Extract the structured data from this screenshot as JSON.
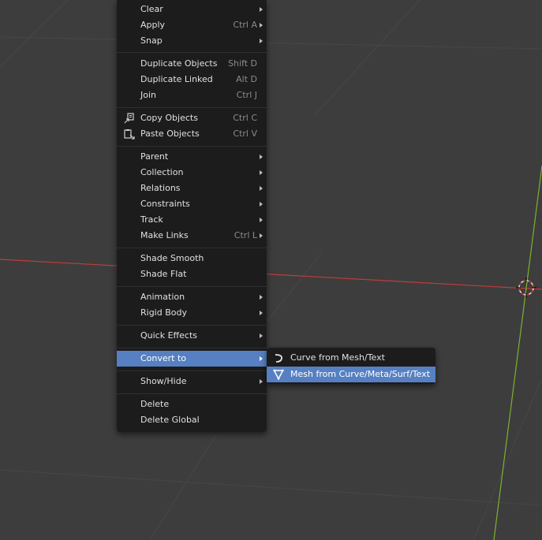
{
  "menu": {
    "items": [
      {
        "label": "Clear",
        "shortcut": "",
        "submenu": true
      },
      {
        "label": "Apply",
        "shortcut": "Ctrl A",
        "submenu": true
      },
      {
        "label": "Snap",
        "shortcut": "",
        "submenu": true
      },
      {
        "label": "Duplicate Objects",
        "shortcut": "Shift D",
        "submenu": false
      },
      {
        "label": "Duplicate Linked",
        "shortcut": "Alt D",
        "submenu": false
      },
      {
        "label": "Join",
        "shortcut": "Ctrl J",
        "submenu": false
      },
      {
        "label": "Copy Objects",
        "shortcut": "Ctrl C",
        "submenu": false,
        "icon": "copy-icon"
      },
      {
        "label": "Paste Objects",
        "shortcut": "Ctrl V",
        "submenu": false,
        "icon": "paste-icon"
      },
      {
        "label": "Parent",
        "shortcut": "",
        "submenu": true
      },
      {
        "label": "Collection",
        "shortcut": "",
        "submenu": true
      },
      {
        "label": "Relations",
        "shortcut": "",
        "submenu": true
      },
      {
        "label": "Constraints",
        "shortcut": "",
        "submenu": true
      },
      {
        "label": "Track",
        "shortcut": "",
        "submenu": true
      },
      {
        "label": "Make Links",
        "shortcut": "Ctrl L",
        "submenu": true
      },
      {
        "label": "Shade Smooth",
        "shortcut": "",
        "submenu": false
      },
      {
        "label": "Shade Flat",
        "shortcut": "",
        "submenu": false
      },
      {
        "label": "Animation",
        "shortcut": "",
        "submenu": true
      },
      {
        "label": "Rigid Body",
        "shortcut": "",
        "submenu": true
      },
      {
        "label": "Quick Effects",
        "shortcut": "",
        "submenu": true
      },
      {
        "label": "Convert to",
        "shortcut": "",
        "submenu": true,
        "active": true
      },
      {
        "label": "Show/Hide",
        "shortcut": "",
        "submenu": true
      },
      {
        "label": "Delete",
        "shortcut": "",
        "submenu": false
      },
      {
        "label": "Delete Global",
        "shortcut": "",
        "submenu": false
      }
    ]
  },
  "submenu": {
    "items": [
      {
        "label": "Curve from Mesh/Text",
        "icon": "curve-icon"
      },
      {
        "label": "Mesh from Curve/Meta/Surf/Text",
        "icon": "mesh-icon",
        "active": true
      }
    ]
  },
  "colors": {
    "viewport_bg": "#3d3d3d",
    "menu_bg": "#1c1c1c",
    "highlight": "#5680c2",
    "x_axis": "#c23b3b",
    "y_axis": "#7ab32e"
  }
}
